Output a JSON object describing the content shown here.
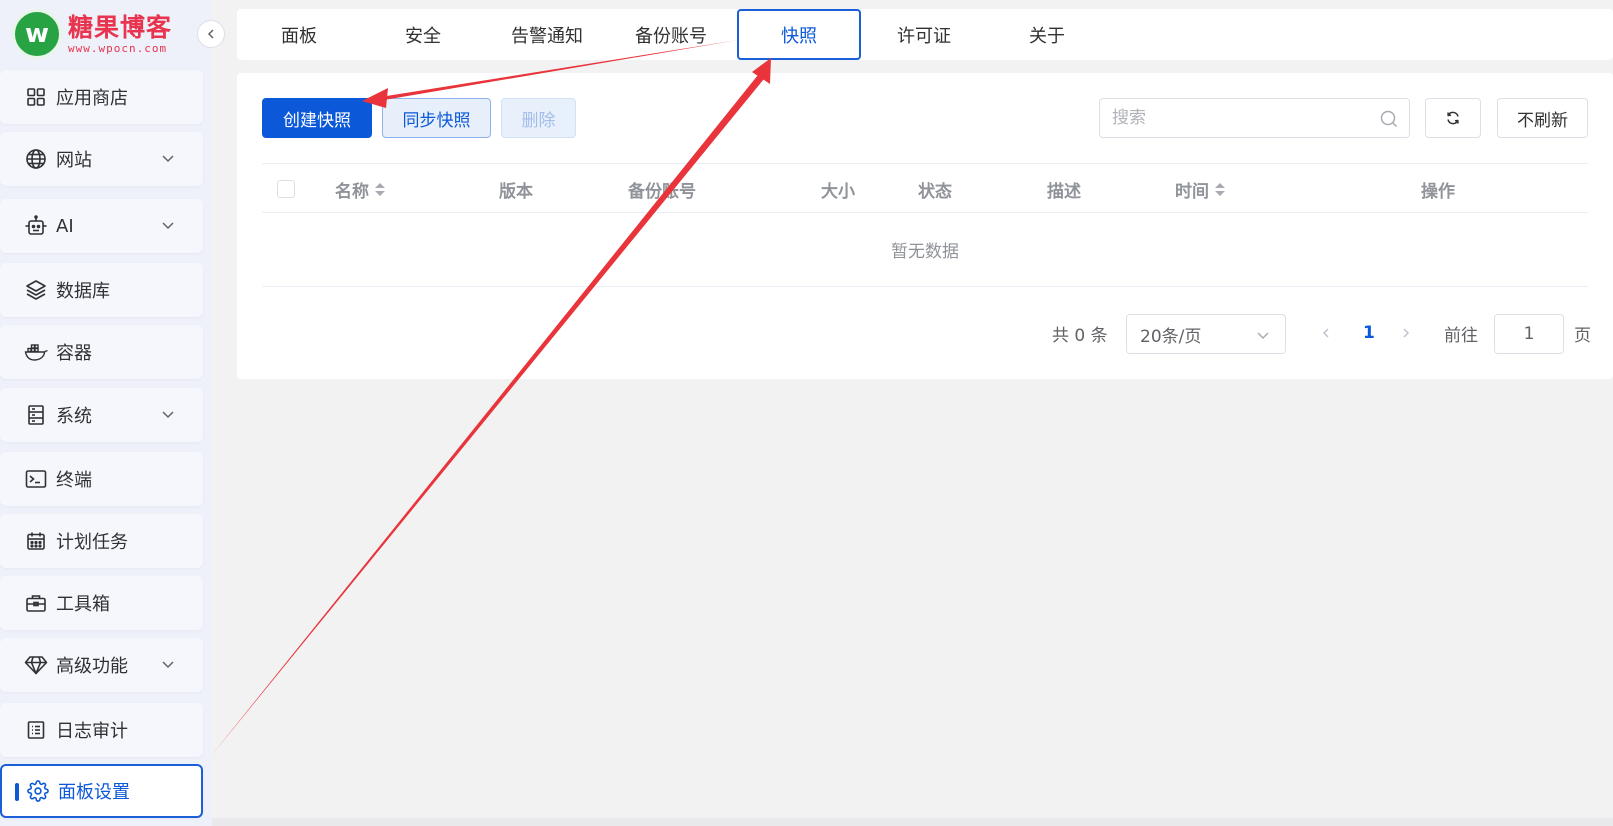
{
  "brand": {
    "logo_letter": "w",
    "title": "糖果博客",
    "url": "www.wpocn.com",
    "color": "#e8344e"
  },
  "sidebar": {
    "items": [
      {
        "label": "应用商店",
        "icon": "grid-icon",
        "has_arrow": false
      },
      {
        "label": "网站",
        "icon": "globe-icon",
        "has_arrow": true
      },
      {
        "label": "AI",
        "icon": "robot-icon",
        "has_arrow": true
      },
      {
        "label": "数据库",
        "icon": "layers-icon",
        "has_arrow": false
      },
      {
        "label": "容器",
        "icon": "docker-icon",
        "has_arrow": false
      },
      {
        "label": "系统",
        "icon": "server-icon",
        "has_arrow": true
      },
      {
        "label": "终端",
        "icon": "terminal-icon",
        "has_arrow": false
      },
      {
        "label": "计划任务",
        "icon": "calendar-icon",
        "has_arrow": false
      },
      {
        "label": "工具箱",
        "icon": "toolbox-icon",
        "has_arrow": false
      },
      {
        "label": "高级功能",
        "icon": "diamond-icon",
        "has_arrow": true
      },
      {
        "label": "日志审计",
        "icon": "log-icon",
        "has_arrow": false
      },
      {
        "label": "面板设置",
        "icon": "gear-icon",
        "has_arrow": false,
        "active": true
      }
    ]
  },
  "tabs": [
    {
      "label": "面板"
    },
    {
      "label": "安全"
    },
    {
      "label": "告警通知"
    },
    {
      "label": "备份账号"
    },
    {
      "label": "快照",
      "active": true
    },
    {
      "label": "许可证"
    },
    {
      "label": "关于"
    }
  ],
  "toolbar": {
    "create_label": "创建快照",
    "sync_label": "同步快照",
    "delete_label": "删除",
    "search_placeholder": "搜索",
    "no_refresh_label": "不刷新"
  },
  "table": {
    "columns": [
      {
        "label": "名称",
        "sortable": true
      },
      {
        "label": "版本",
        "sortable": false
      },
      {
        "label": "备份账号",
        "sortable": false
      },
      {
        "label": "大小",
        "sortable": false
      },
      {
        "label": "状态",
        "sortable": false
      },
      {
        "label": "描述",
        "sortable": false
      },
      {
        "label": "时间",
        "sortable": true
      },
      {
        "label": "操作",
        "sortable": false
      }
    ],
    "empty_text": "暂无数据"
  },
  "pagination": {
    "total_text": "共 0 条",
    "page_size": "20条/页",
    "current_page": "1",
    "goto_label": "前往",
    "goto_value": "1",
    "page_suffix": "页"
  },
  "colors": {
    "primary": "#0b58d8",
    "annotation_arrow": "#e8343a"
  }
}
